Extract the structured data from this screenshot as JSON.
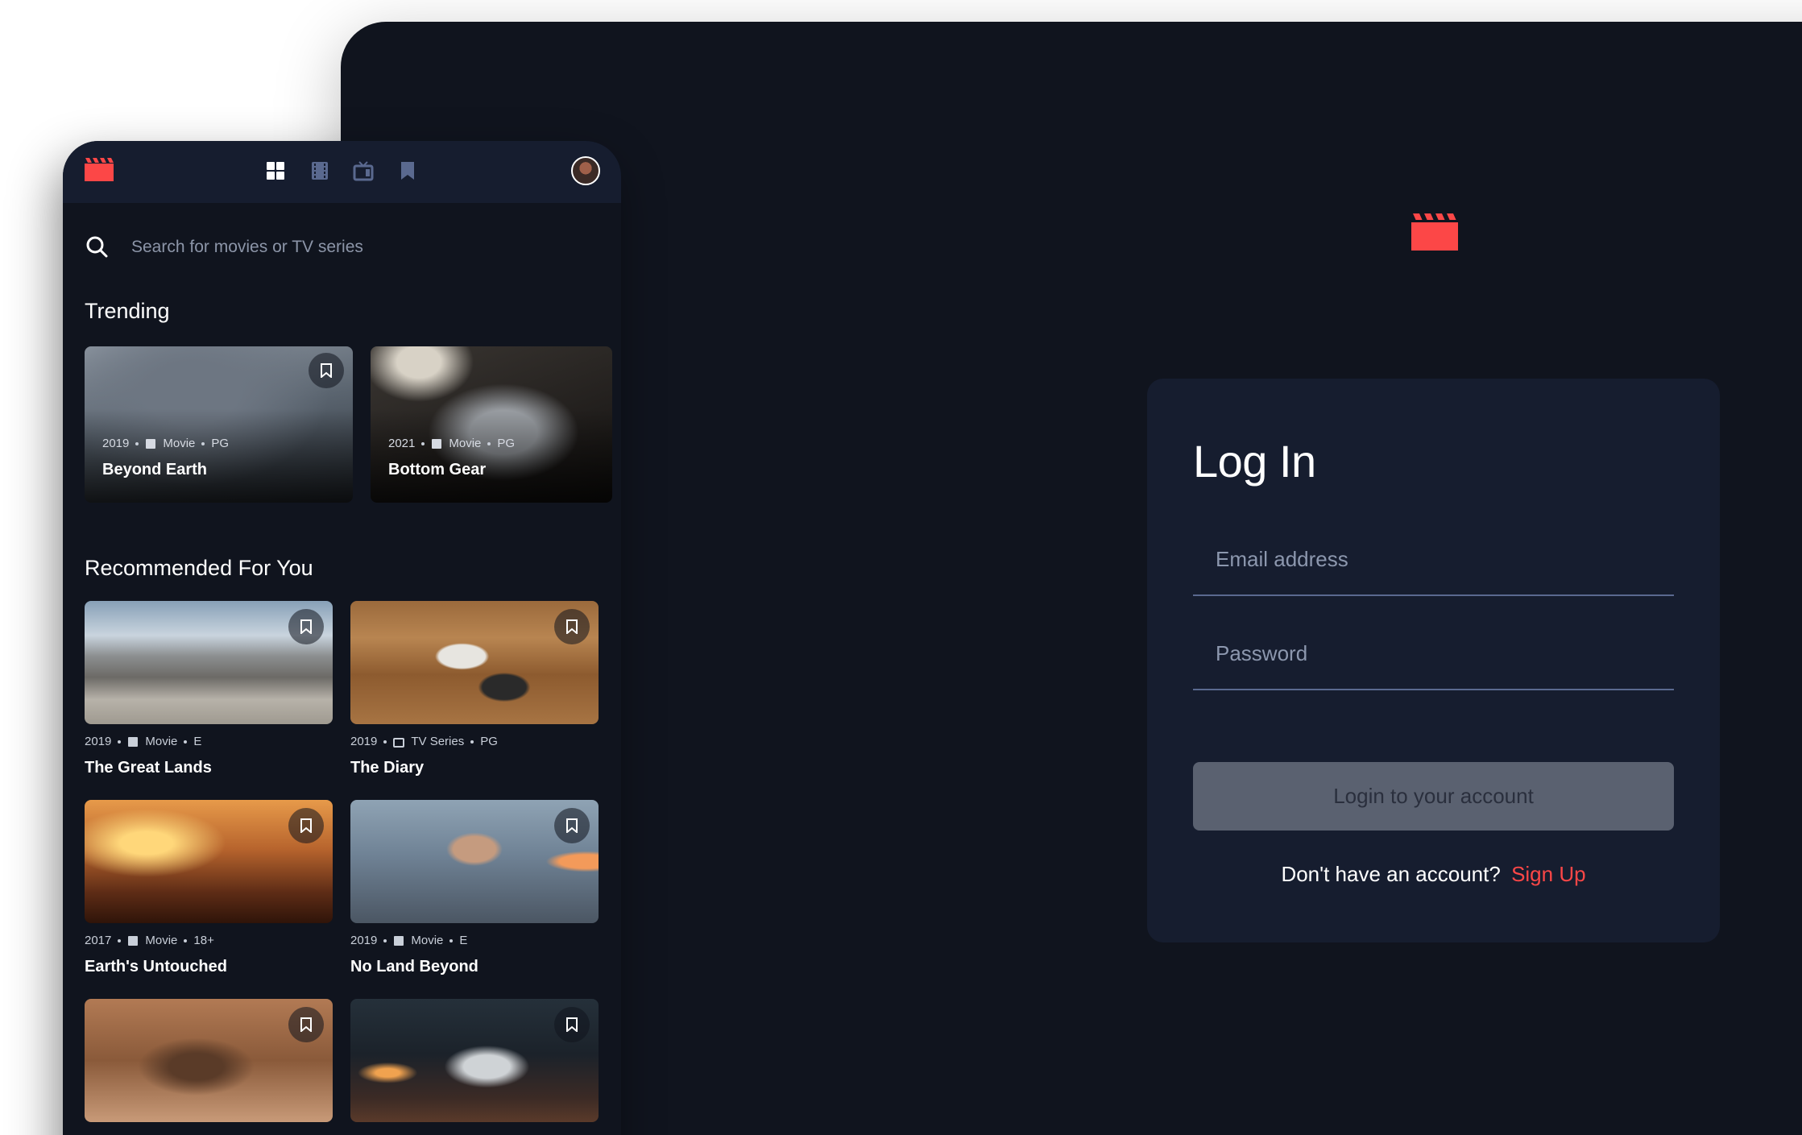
{
  "colors": {
    "accent": "#fc4747",
    "bg": "#10141e",
    "surface": "#161d2f",
    "muted": "#5a698f"
  },
  "login": {
    "title": "Log In",
    "email_placeholder": "Email address",
    "password_placeholder": "Password",
    "submit_label": "Login to your account",
    "signup_prompt": "Don't have an account?",
    "signup_link": "Sign Up"
  },
  "mobile": {
    "nav": [
      "home-grid-icon",
      "movies-film-icon",
      "tv-series-icon",
      "bookmark-icon"
    ],
    "search_placeholder": "Search for movies or TV series",
    "trending_title": "Trending",
    "trending": [
      {
        "year": "2019",
        "category": "Movie",
        "rating": "PG",
        "title": "Beyond Earth"
      },
      {
        "year": "2021",
        "category": "Movie",
        "rating": "PG",
        "title": "Bottom Gear"
      }
    ],
    "recommended_title": "Recommended For You",
    "recommended": [
      {
        "year": "2019",
        "category": "Movie",
        "rating": "E",
        "title": "The Great Lands"
      },
      {
        "year": "2019",
        "category": "TV Series",
        "rating": "PG",
        "title": "The Diary"
      },
      {
        "year": "2017",
        "category": "Movie",
        "rating": "18+",
        "title": "Earth's Untouched"
      },
      {
        "year": "2019",
        "category": "Movie",
        "rating": "E",
        "title": "No Land Beyond"
      }
    ]
  }
}
